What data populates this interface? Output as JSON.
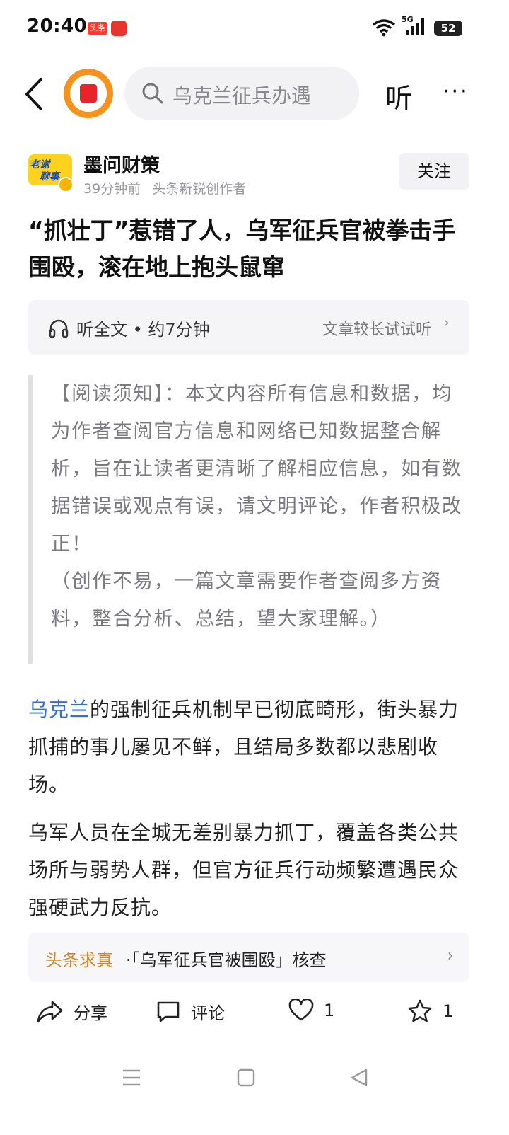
{
  "status_bar": {
    "time": "20:40",
    "app_badge": "头条",
    "battery": "52",
    "network": "5G"
  },
  "search": {
    "placeholder": "乌克兰征兵办遇"
  },
  "header": {
    "listen_label": "听",
    "more_label": "···"
  },
  "author": {
    "avatar_text_top": "老谢",
    "avatar_text_bottom": "聊事",
    "name": "墨问财策",
    "time": "39分钟前",
    "role": "头条新锐创作者",
    "follow_label": "关注"
  },
  "article": {
    "title": "“抓壮丁”惹错了人，乌军征兵官被拳击手围殴，滚在地上抱头鼠窜",
    "listen_bar": {
      "left": "听全文 • 约7分钟",
      "right": "文章较长试试听"
    },
    "notice_p1": "【阅读须知】：本文内容所有信息和数据，均为作者查阅官方信息和网络已知数据整合解析，旨在让读者更清晰了解相应信息，如有数据错误或观点有误，请文明评论，作者积极改正！",
    "notice_p2": "（创作不易，一篇文章需要作者查阅多方资料，整合分析、总结，望大家理解。）",
    "p1_link": "乌克兰",
    "p1_rest": "的强制征兵机制早已彻底畸形，街头暴力抓捕的事儿屡见不鲜，且结局多数都以悲剧收场。",
    "p2": "乌军人员在全城无差别暴力抓丁，覆盖各类公共场所与弱势人群，但官方征兵行动频繁遭遇民众强硬武力反抗。"
  },
  "factcheck": {
    "label": "头条求真",
    "text": "·「乌军征兵官被围殴」核查"
  },
  "actions": {
    "share": "分享",
    "comment": "评论",
    "like_count": "1",
    "favorite_count": "1"
  },
  "colors": {
    "link": "#2e6fd8",
    "factcheck_label": "#d4862a",
    "logo_orange": "#f6931e"
  }
}
